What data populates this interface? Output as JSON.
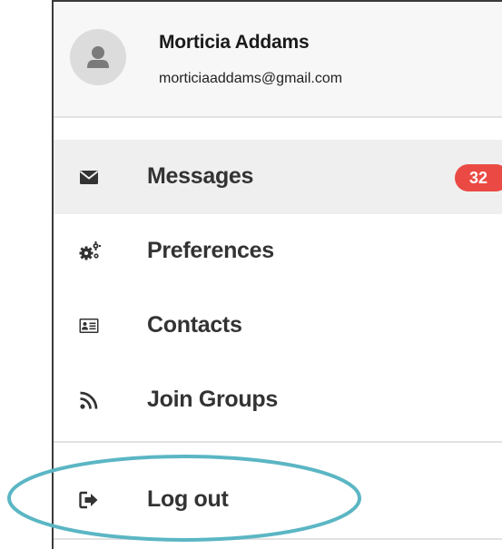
{
  "user": {
    "name": "Morticia Addams",
    "email": "morticiaaddams@gmail.com",
    "avatar_icon": "user-silhouette-icon"
  },
  "menu": {
    "items": [
      {
        "label": "Messages",
        "icon": "envelope-icon",
        "active": true,
        "badge": "32"
      },
      {
        "label": "Preferences",
        "icon": "gears-icon",
        "active": false
      },
      {
        "label": "Contacts",
        "icon": "contact-card-icon",
        "active": false
      },
      {
        "label": "Join Groups",
        "icon": "rss-feed-icon",
        "active": false
      }
    ],
    "logout": {
      "label": "Log out",
      "icon": "sign-out-icon"
    }
  },
  "colors": {
    "badge": "#ea4a43",
    "highlight_ring": "#5bb6c4",
    "active_row": "#efefef",
    "text": "#333333"
  }
}
